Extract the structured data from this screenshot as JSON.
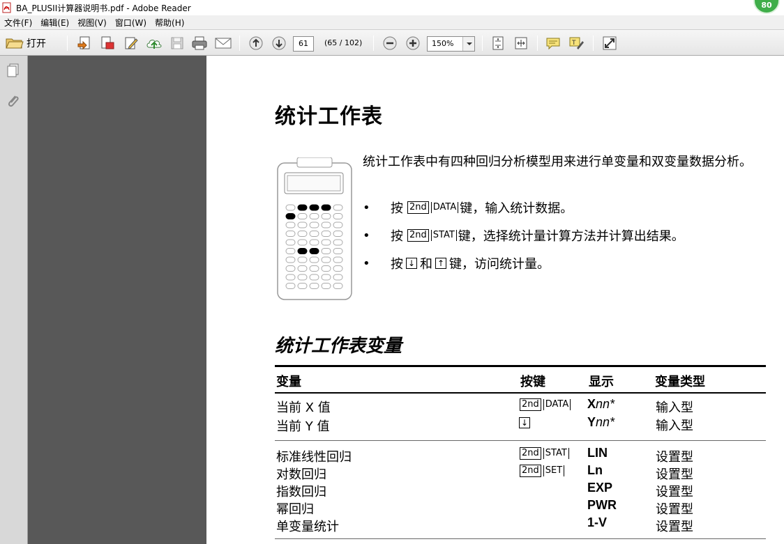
{
  "window": {
    "title": "BA_PLUSII计算器说明书.pdf - Adobe Reader",
    "badge": "80"
  },
  "menu": [
    "文件(F)",
    "编辑(E)",
    "视图(V)",
    "窗口(W)",
    "帮助(H)"
  ],
  "toolbar": {
    "open_label": "打开",
    "page_number": "61",
    "page_count": "(65 / 102)",
    "zoom": "150%"
  },
  "doc": {
    "heading": "统计工作表",
    "intro": "统计工作表中有四种回归分析模型用来进行单变量和双变量数据分析。",
    "bullet1": {
      "pre": "按",
      "k1": "2nd",
      "k2": "DATA",
      "post": "键，输入统计数据。"
    },
    "bullet2": {
      "pre": "按",
      "k1": "2nd",
      "k2": "STAT",
      "post": "键，选择统计量计算方法并计算出结果。"
    },
    "bullet3": {
      "pre": "按",
      "down": "↓",
      "mid": "和",
      "up": "↑",
      "post": "键，访问统计量。"
    },
    "subheading": "统计工作表变量",
    "table": {
      "headers": [
        "变量",
        "按键",
        "显示",
        "变量类型"
      ],
      "group1": {
        "vars": [
          "当前 X 值",
          "当前 Y 值"
        ],
        "keys": {
          "k1": "2nd",
          "k2": "DATA",
          "arrow": "↓"
        },
        "displays": [
          {
            "b": "X",
            "i": "nn*"
          },
          {
            "b": "Y",
            "i": "nn*"
          }
        ],
        "types": [
          "输入型",
          "输入型"
        ]
      },
      "group2": {
        "vars": [
          "标准线性回归",
          "对数回归",
          "指数回归",
          "幂回归",
          "单变量统计"
        ],
        "keys": {
          "row1_k1": "2nd",
          "row1_k2": "STAT",
          "row2_k1": "2nd",
          "row2_k2": "SET"
        },
        "displays": [
          "LIN",
          "Ln",
          "EXP",
          "PWR",
          "1-V"
        ],
        "types": [
          "设置型",
          "设置型",
          "设置型",
          "设置型",
          "设置型"
        ]
      }
    }
  }
}
